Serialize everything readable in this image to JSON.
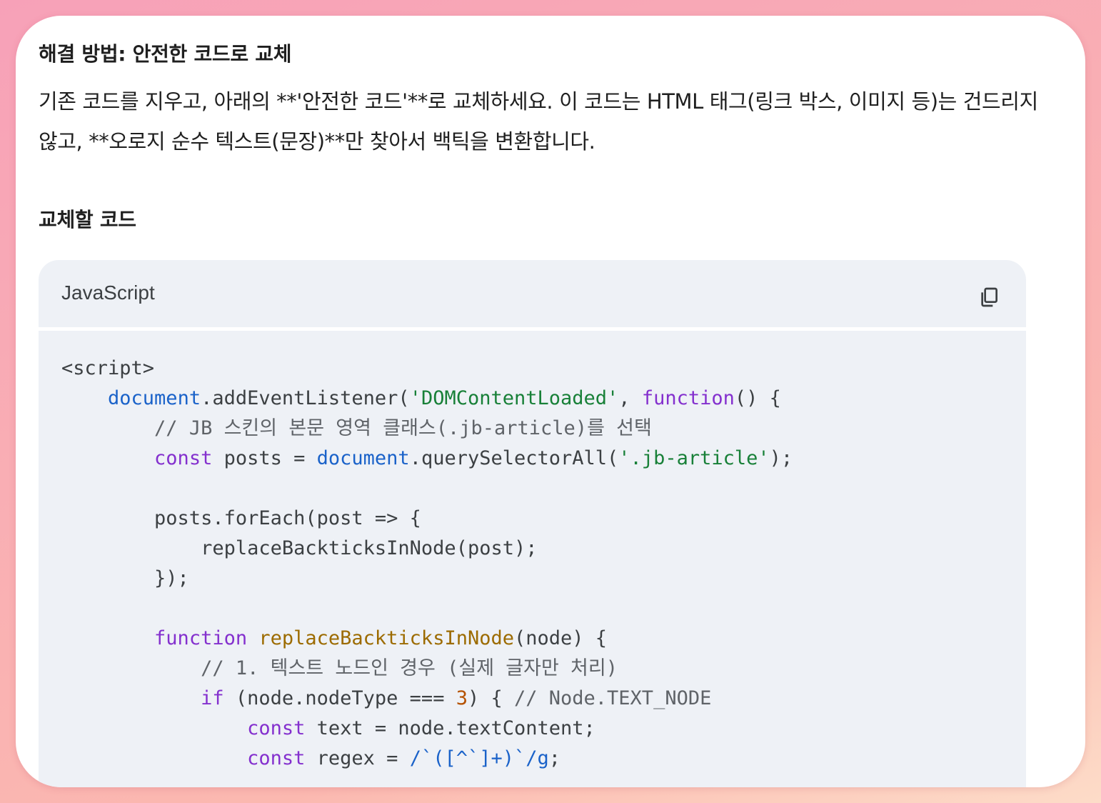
{
  "heading_main": "해결 방법: 안전한 코드로 교체",
  "paragraph": "기존 코드를 지우고, 아래의 **'안전한 코드'**로 교체하세요. 이 코드는 HTML 태그(링크 박스, 이미지 등)는 건드리지 않고, **오로지 순수 텍스트(문장)**만 찾아서 백틱을 변환합니다.",
  "heading_sub": "교체할 코드",
  "code_block": {
    "language": "JavaScript",
    "copy_icon": "copy-icon",
    "lines": [
      [
        {
          "t": "<script>",
          "c": "plain"
        }
      ],
      [
        {
          "t": "    ",
          "c": "plain"
        },
        {
          "t": "document",
          "c": "obj"
        },
        {
          "t": ".addEventListener(",
          "c": "plain"
        },
        {
          "t": "'DOMContentLoaded'",
          "c": "str"
        },
        {
          "t": ", ",
          "c": "plain"
        },
        {
          "t": "function",
          "c": "kw"
        },
        {
          "t": "() {",
          "c": "plain"
        }
      ],
      [
        {
          "t": "        ",
          "c": "plain"
        },
        {
          "t": "// JB 스킨의 본문 영역 클래스(.jb-article)를 선택",
          "c": "com"
        }
      ],
      [
        {
          "t": "        ",
          "c": "plain"
        },
        {
          "t": "const",
          "c": "kw"
        },
        {
          "t": " posts = ",
          "c": "plain"
        },
        {
          "t": "document",
          "c": "obj"
        },
        {
          "t": ".querySelectorAll(",
          "c": "plain"
        },
        {
          "t": "'.jb-article'",
          "c": "str"
        },
        {
          "t": ");",
          "c": "plain"
        }
      ],
      [
        {
          "t": "",
          "c": "plain"
        }
      ],
      [
        {
          "t": "        posts.forEach(post => {",
          "c": "plain"
        }
      ],
      [
        {
          "t": "            replaceBackticksInNode(post);",
          "c": "plain"
        }
      ],
      [
        {
          "t": "        });",
          "c": "plain"
        }
      ],
      [
        {
          "t": "",
          "c": "plain"
        }
      ],
      [
        {
          "t": "        ",
          "c": "plain"
        },
        {
          "t": "function",
          "c": "kw"
        },
        {
          "t": " ",
          "c": "plain"
        },
        {
          "t": "replaceBackticksInNode",
          "c": "fn"
        },
        {
          "t": "(node) {",
          "c": "plain"
        }
      ],
      [
        {
          "t": "            ",
          "c": "plain"
        },
        {
          "t": "// 1. 텍스트 노드인 경우 (실제 글자만 처리)",
          "c": "com"
        }
      ],
      [
        {
          "t": "            ",
          "c": "plain"
        },
        {
          "t": "if",
          "c": "kw"
        },
        {
          "t": " (node.nodeType === ",
          "c": "plain"
        },
        {
          "t": "3",
          "c": "num"
        },
        {
          "t": ") { ",
          "c": "plain"
        },
        {
          "t": "// Node.TEXT_NODE",
          "c": "com"
        }
      ],
      [
        {
          "t": "                ",
          "c": "plain"
        },
        {
          "t": "const",
          "c": "kw"
        },
        {
          "t": " text = node.textContent;",
          "c": "plain"
        }
      ],
      [
        {
          "t": "                ",
          "c": "plain"
        },
        {
          "t": "const",
          "c": "kw"
        },
        {
          "t": " regex = ",
          "c": "plain"
        },
        {
          "t": "/`([^`]+)`/g",
          "c": "re"
        },
        {
          "t": ";",
          "c": "plain"
        }
      ]
    ]
  },
  "colors": {
    "keyword": "#8430ce",
    "builtin_object": "#1a62c9",
    "string": "#188038",
    "comment": "#5f6368",
    "function_name": "#9c6b00",
    "number": "#b55200",
    "regex": "#1a62c9",
    "code_background": "#eef1f6"
  }
}
